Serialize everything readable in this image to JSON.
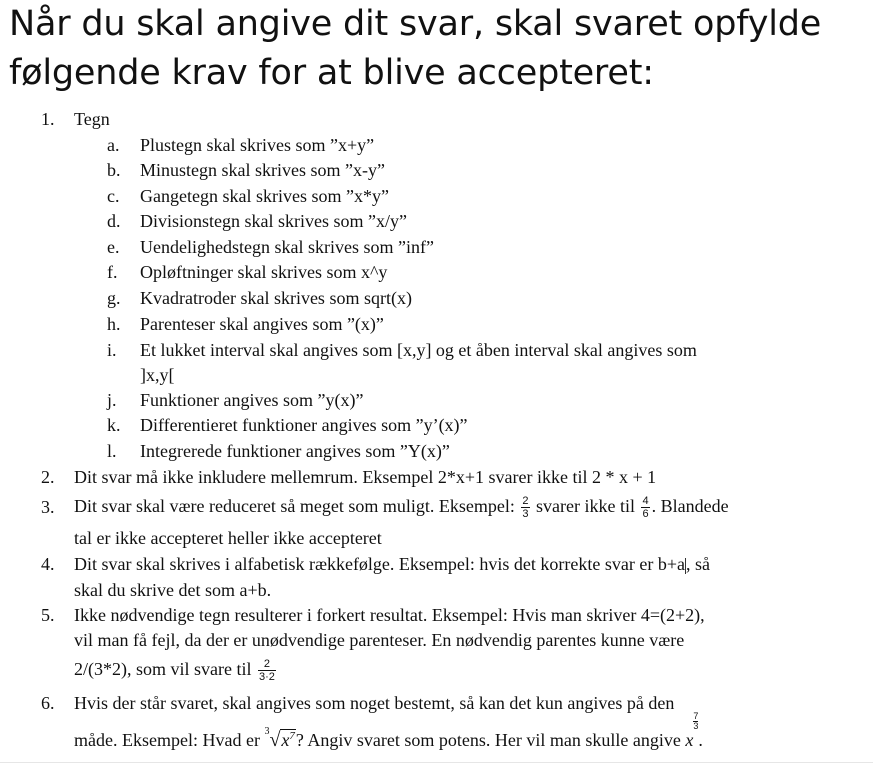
{
  "heading": {
    "line1": "Når du skal angive dit svar, skal svaret opfylde",
    "line2": "følgende krav for at blive accepteret:"
  },
  "items": [
    {
      "num": "1.",
      "text": "Tegn"
    },
    {
      "num": "2.",
      "text": "Dit svar må ikke inkludere mellemrum. Eksempel 2*x+1 svarer ikke til 2 * x + 1"
    },
    {
      "num": "3.",
      "a": "Dit svar skal være reduceret så meget som muligt. Eksempel:",
      "frac1_num": "2",
      "frac1_den": "3",
      "b": "svarer ikke til",
      "frac2_num": "4",
      "frac2_den": "6",
      "c": ". Blandede",
      "line2": "tal er ikke accepteret heller ikke accepteret"
    },
    {
      "num": "4.",
      "line1_a": "Dit svar skal skrives i alfabetisk rækkefølge. Eksempel: hvis det korrekte svar er b+a",
      "line1_b": ", så",
      "line2": "skal du skrive det som a+b."
    },
    {
      "num": "5.",
      "line1": "Ikke nødvendige tegn resulterer i forkert resultat. Eksempel: Hvis man skriver 4=(2+2),",
      "line2": "vil man få fejl, da der er unødvendige parenteser. En nødvendig parentes kunne være",
      "line3": "2/(3*2), som vil svare til",
      "frac_num": "2",
      "frac_den": "3·2"
    },
    {
      "num": "6.",
      "line1": "Hvis der står svaret, skal angives som noget bestemt, så kan det kun angives på den",
      "line2_a": "måde. Eksempel: Hvad er",
      "root_index": "3",
      "root_base": "x",
      "root_exp": "7",
      "line2_b": "? Angiv svaret som potens. Her vil man skulle angive",
      "pow_base": "x",
      "pow_exp_num": "7",
      "pow_exp_den": "3",
      "line2_c": "."
    }
  ],
  "subitems": [
    {
      "letter": "a.",
      "text": "Plustegn skal skrives som ”x+y”"
    },
    {
      "letter": "b.",
      "text": "Minustegn skal skrives som ”x-y”"
    },
    {
      "letter": "c.",
      "text": "Gangetegn skal skrives som ”x*y”"
    },
    {
      "letter": "d.",
      "text": "Divisionstegn skal skrives som ”x/y”"
    },
    {
      "letter": "e.",
      "text": "Uendelighedstegn skal skrives som ”inf”"
    },
    {
      "letter": "f.",
      "text": "Opløftninger skal skrives som x^y"
    },
    {
      "letter": "g.",
      "text": "Kvadratroder skal skrives som sqrt(x)"
    },
    {
      "letter": "h.",
      "text": "Parenteser skal angives som ”(x)”"
    },
    {
      "letter": "i.",
      "text": "Et lukket interval skal angives som [x,y] og et åben interval skal angives som",
      "text2": "]x,y["
    },
    {
      "letter": "j.",
      "text": "Funktioner angives som ”y(x)”"
    },
    {
      "letter": "k.",
      "text": "Differentieret funktioner angives som ”y’(x)”"
    },
    {
      "letter": "l.",
      "text": "Integrerede funktioner angives som ”Y(x)”"
    }
  ]
}
